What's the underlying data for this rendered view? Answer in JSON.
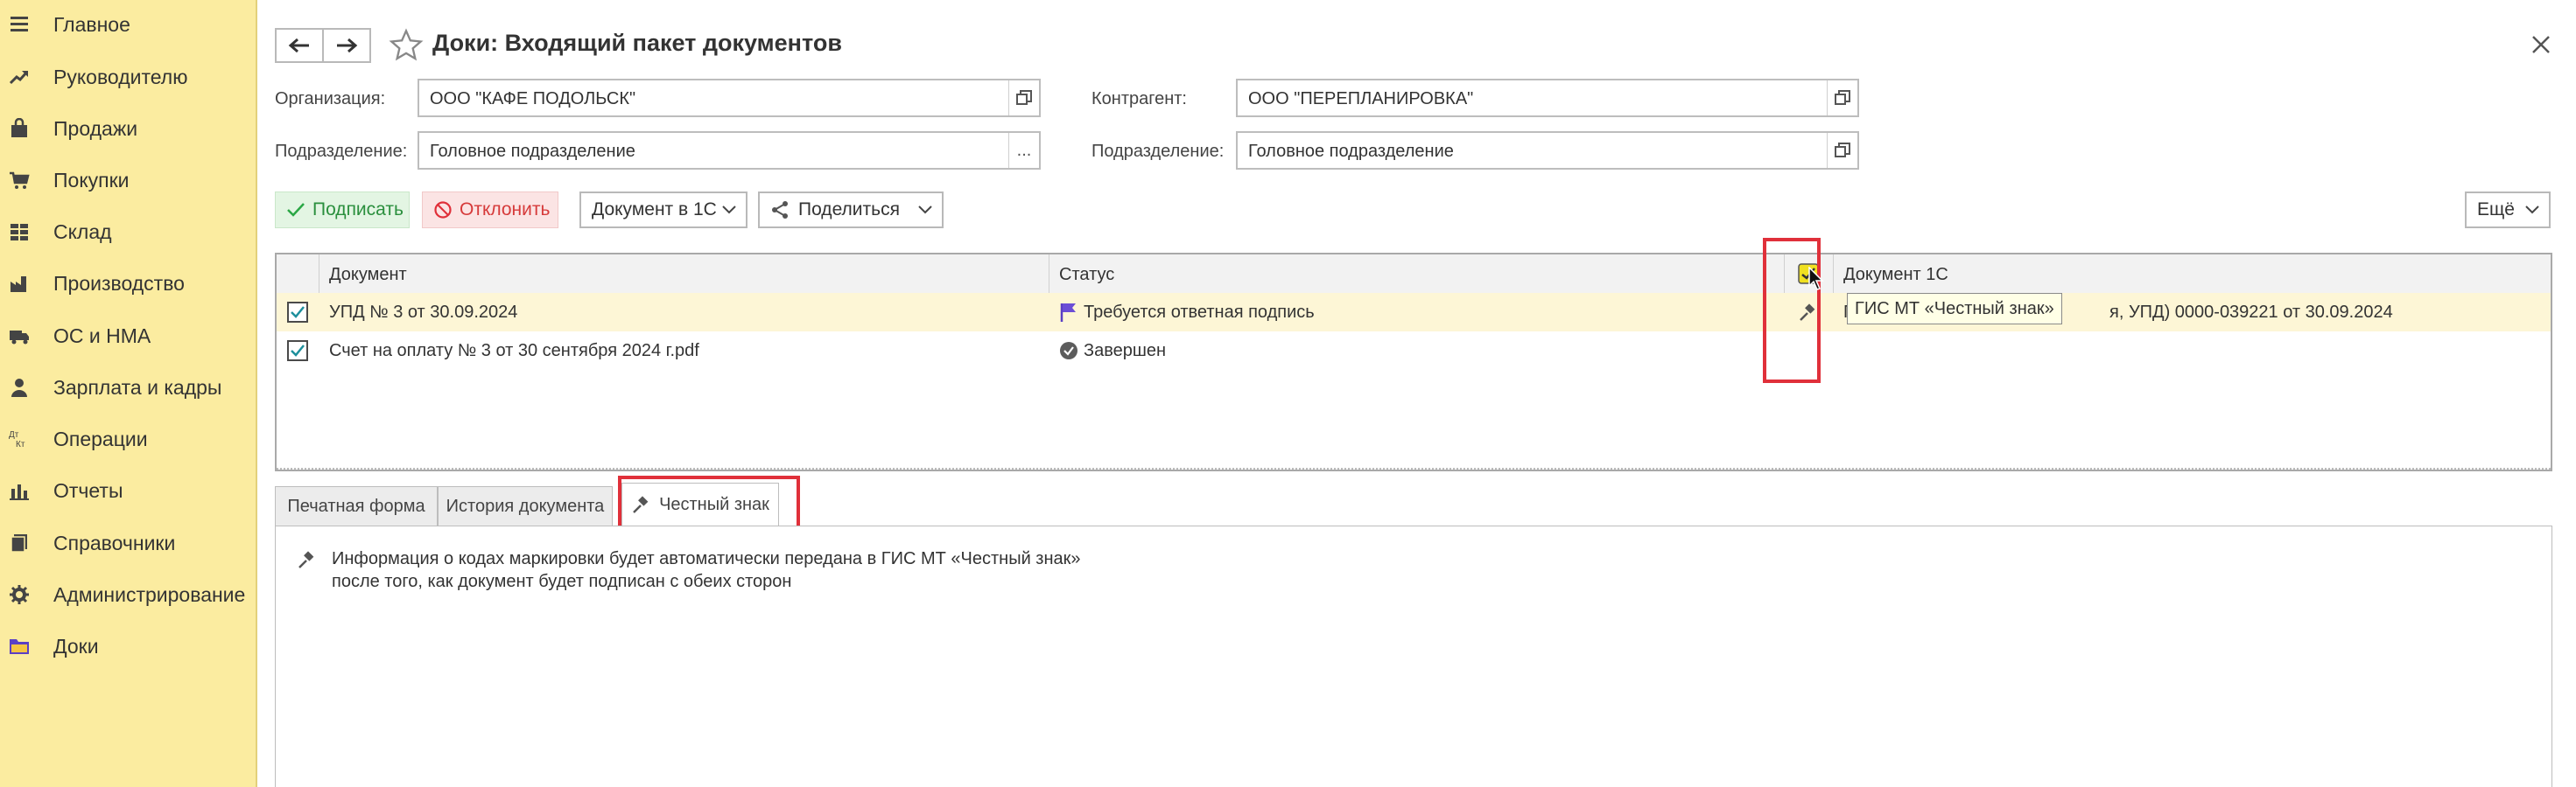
{
  "sidebar": {
    "items": [
      {
        "label": "Главное",
        "icon": "menu-lines-icon"
      },
      {
        "label": "Руководителю",
        "icon": "trend-up-icon"
      },
      {
        "label": "Продажи",
        "icon": "shopping-bag-icon"
      },
      {
        "label": "Покупки",
        "icon": "cart-icon"
      },
      {
        "label": "Склад",
        "icon": "warehouse-grid-icon"
      },
      {
        "label": "Производство",
        "icon": "factory-icon"
      },
      {
        "label": "ОС и НМА",
        "icon": "truck-icon"
      },
      {
        "label": "Зарплата и кадры",
        "icon": "person-icon"
      },
      {
        "label": "Операции",
        "icon": "dt-kt-icon"
      },
      {
        "label": "Отчеты",
        "icon": "bar-chart-icon"
      },
      {
        "label": "Справочники",
        "icon": "books-icon"
      },
      {
        "label": "Администрирование",
        "icon": "gear-icon"
      },
      {
        "label": "Доки",
        "icon": "folder-icon"
      }
    ],
    "icon_glyph_dt": "Дт",
    "icon_glyph_kt": "Кт"
  },
  "header": {
    "title": "Доки: Входящий пакет документов"
  },
  "form": {
    "org_label": "Организация:",
    "org_value": "ООО \"КАФЕ ПОДОЛЬСК\"",
    "counterparty_label": "Контрагент:",
    "counterparty_value": "ООО \"ПЕРЕПЛАНИРОВКА\"",
    "dept_label": "Подразделение:",
    "dept_value": "Головное подразделение",
    "dept2_label": "Подразделение:",
    "dept2_value": "Головное подразделение",
    "ellipsis": "..."
  },
  "toolbar": {
    "sign": "Подписать",
    "reject": "Отклонить",
    "doc1c": "Документ в 1С",
    "share": "Поделиться",
    "more": "Ещё"
  },
  "table": {
    "headers": {
      "document": "Документ",
      "status": "Статус",
      "doc1c": "Документ 1С"
    },
    "rows": [
      {
        "checked": true,
        "document": "УПД № 3 от 30.09.2024",
        "status": "Требуется ответная подпись",
        "doc1c_prefix": "П",
        "doc1c_suffix": "я, УПД) 0000-039221 от 30.09.2024"
      },
      {
        "checked": true,
        "document": "Счет на оплату № 3 от 30 сентября 2024 г.pdf",
        "status": "Завершен",
        "doc1c_prefix": "",
        "doc1c_suffix": ""
      }
    ],
    "tooltip": "ГИС МТ «Честный знак»"
  },
  "tabs": [
    {
      "label": "Печатная форма"
    },
    {
      "label": "История документа"
    },
    {
      "label": "Честный знак"
    }
  ],
  "tab_content": {
    "line1": "Информация о кодах маркировки будет автоматически передана в ГИС МТ «Честный знак»",
    "line2": "после того, как документ будет подписан с обеих сторон"
  },
  "colors": {
    "sidebar_bg": "#fbeca0",
    "selected_row": "#fdf6d6",
    "highlight": "#e0303a",
    "sign_green": "#2aa745",
    "reject_red": "#e0303a",
    "flag_purple": "#6b4ed6"
  }
}
